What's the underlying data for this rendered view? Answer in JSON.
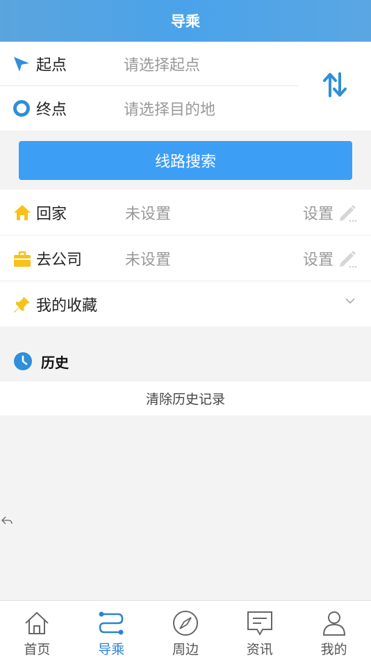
{
  "header": {
    "title": "导乘"
  },
  "route": {
    "start": {
      "label": "起点",
      "placeholder": "请选择起点"
    },
    "end": {
      "label": "终点",
      "placeholder": "请选择目的地"
    }
  },
  "search_button": "线路搜索",
  "places": {
    "home": {
      "label": "回家",
      "value": "未设置",
      "action": "设置"
    },
    "work": {
      "label": "去公司",
      "value": "未设置",
      "action": "设置"
    },
    "favorites": {
      "label": "我的收藏"
    }
  },
  "history": {
    "title": "历史",
    "clear_label": "清除历史记录"
  },
  "tabs": [
    {
      "label": "首页",
      "icon": "home-icon"
    },
    {
      "label": "导乘",
      "icon": "route-icon"
    },
    {
      "label": "周边",
      "icon": "compass-icon"
    },
    {
      "label": "资讯",
      "icon": "message-icon"
    },
    {
      "label": "我的",
      "icon": "person-icon"
    }
  ],
  "colors": {
    "accent": "#3d9ef6",
    "active_tab": "#2b83d6",
    "home_icon": "#f6c21b"
  }
}
